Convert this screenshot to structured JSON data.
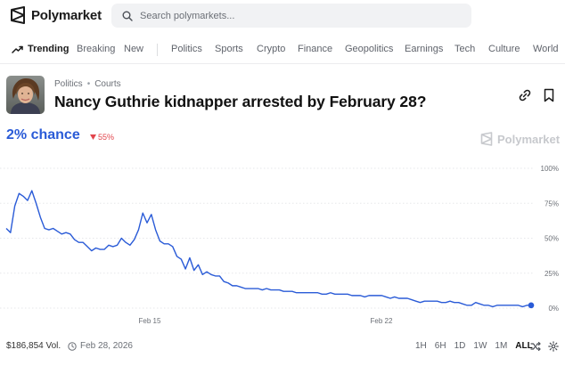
{
  "header": {
    "brand": "Polymarket",
    "search_placeholder": "Search polymarkets..."
  },
  "nav": {
    "trending": "Trending",
    "items": [
      "Breaking",
      "New",
      "Politics",
      "Sports",
      "Crypto",
      "Finance",
      "Geopolitics",
      "Earnings",
      "Tech",
      "Culture",
      "World"
    ]
  },
  "market": {
    "breadcrumb": [
      "Politics",
      "Courts"
    ],
    "title": "Nancy Guthrie kidnapper arrested by February 28?",
    "chance": "2% chance",
    "change": "55%",
    "watermark": "Polymarket"
  },
  "chart_data": {
    "type": "line",
    "x_ticks": [
      "Feb 15",
      "Feb 22"
    ],
    "y_ticks": [
      "100%",
      "75%",
      "50%",
      "25%",
      "0%"
    ],
    "ylim": [
      0,
      100
    ],
    "grid": true,
    "series": [
      {
        "color": "#2a5bd7",
        "values": [
          57,
          54,
          73,
          82,
          80,
          77,
          84,
          75,
          65,
          57,
          56,
          57,
          55,
          53,
          54,
          53,
          49,
          47,
          47,
          44,
          41,
          43,
          42,
          42,
          45,
          44,
          45,
          50,
          47,
          45,
          49,
          56,
          68,
          61,
          67,
          56,
          48,
          46,
          46,
          44,
          37,
          35,
          28,
          36,
          27,
          31,
          24,
          26,
          24,
          23,
          23,
          19,
          18,
          16,
          16,
          15,
          14,
          14,
          14,
          14,
          13,
          14,
          13,
          13,
          13,
          12,
          12,
          12,
          11,
          11,
          11,
          11,
          11,
          11,
          10,
          10,
          11,
          10,
          10,
          10,
          10,
          9,
          9,
          9,
          8,
          9,
          9,
          9,
          9,
          8,
          7,
          8,
          7,
          7,
          7,
          6,
          5,
          4,
          5,
          5,
          5,
          5,
          4,
          4,
          5,
          4,
          4,
          3,
          2,
          2,
          4,
          3,
          2,
          2,
          1,
          2,
          2,
          2,
          2,
          2,
          2,
          1,
          2,
          2
        ]
      }
    ]
  },
  "footer": {
    "volume": "$186,854 Vol.",
    "date": "Feb 28, 2026",
    "ranges": [
      "1H",
      "6H",
      "1D",
      "1W",
      "1M",
      "ALL"
    ],
    "active_range": "ALL"
  }
}
